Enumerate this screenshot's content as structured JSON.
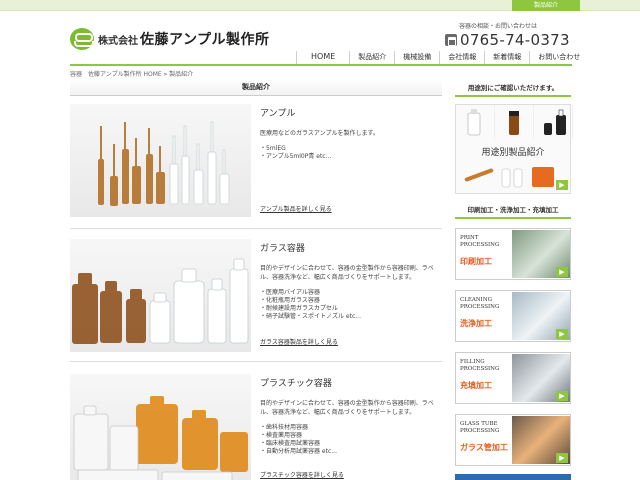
{
  "topbar": {
    "tab_label": "製品紹介"
  },
  "header": {
    "company_prefix": "株式会社",
    "company_name": "佐藤アンプル製作所",
    "contact_label": "容器の相談・お問い合わせは",
    "phone": "0765-74-0373"
  },
  "nav": {
    "items": [
      {
        "label": "HOME"
      },
      {
        "label": "製品紹介"
      },
      {
        "label": "機械設備"
      },
      {
        "label": "会社情報"
      },
      {
        "label": "新着情報"
      },
      {
        "label": "お問い合わせ"
      }
    ]
  },
  "breadcrumb": "容器　佐藤アンプル製作所 HOME » 製品紹介",
  "main": {
    "title": "製品紹介"
  },
  "products": [
    {
      "title": "アンプル",
      "desc": "医療用などのガラスアンプルを製作します。",
      "list": [
        "・5mlEG",
        "・アンプル5ml0P青 etc..."
      ],
      "link": "アンプル製品を詳しく見る"
    },
    {
      "title": "ガラス容器",
      "desc": "目的やデザインに合わせて、容器の金型製作から容器印刷、ラベル、容器洗浄など、幅広く商品づくりをサポートします。",
      "list": [
        "・医療用バイアル容器",
        "・化粧瓶用ガラス容器",
        "・耐候建設用ガラスカプセル",
        "・硝子試験管・スポイトノズル etc..."
      ],
      "link": "ガラス容器製品を詳しく見る"
    },
    {
      "title": "プラスチック容器",
      "desc": "目的やデザインに合わせて、容器の金型製作から容器印刷、ラベル、容器洗浄など、幅広く商品づくりをサポートします。",
      "list": [
        "・歯科技材用容器",
        "・検査薬用容器",
        "・臨床検査用試薬容器",
        "・自動分析用試薬容器 etc..."
      ],
      "link": "プラスチック容器を詳しく見る"
    }
  ],
  "sidebar": {
    "usage_heading": "用途別にご確認いただけます。",
    "usage_title": "用途別製品紹介",
    "services_heading": "印刷加工・洗浄加工・充填加工",
    "services": [
      {
        "en": "PRINT\nPROCESSING",
        "jp": "印刷加工"
      },
      {
        "en": "CLEANING\nPROCESSING",
        "jp": "洗浄加工"
      },
      {
        "en": "FILLING\nPROCESSING",
        "jp": "充填加工"
      },
      {
        "en": "GLASS TUBE\nPROCESSING",
        "jp": "ガラス管加工"
      }
    ]
  },
  "colors": {
    "accent": "#8ec63f",
    "service_text": "#e85a1e"
  }
}
